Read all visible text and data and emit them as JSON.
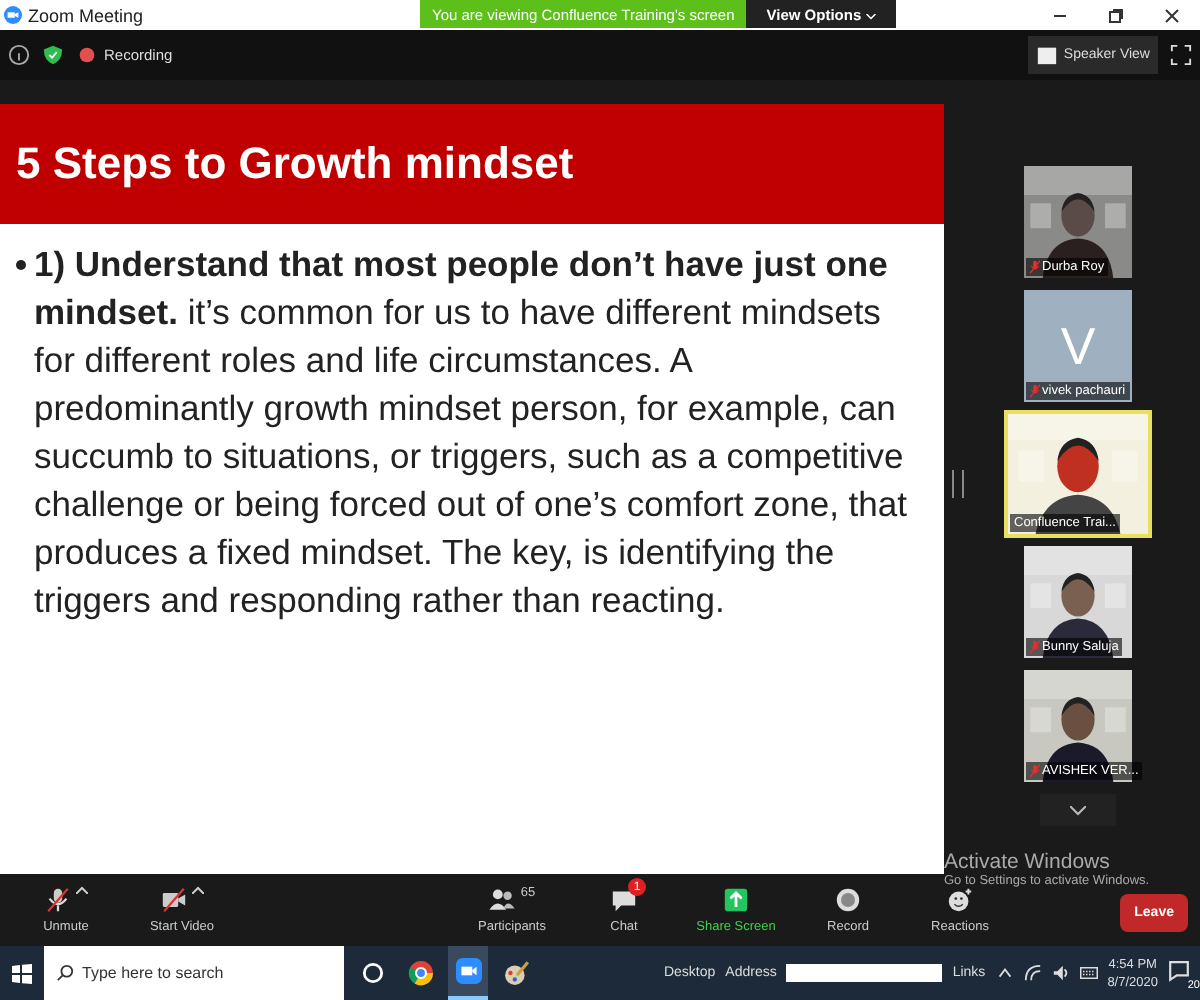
{
  "window": {
    "title": "Zoom Meeting"
  },
  "banner": {
    "text": "You are viewing Confluence Training's screen",
    "button": "View Options"
  },
  "top_bar": {
    "recording": "Recording",
    "view_button": "Speaker View"
  },
  "slide": {
    "title": "5 Steps to Growth mindset",
    "bullet": "**1) Understand that most people don’t have just one mindset.** it’s common for us to have different mindsets for different roles and life circumstances. A predominantly growth mindset person, for example, can succumb to situations, or triggers, such as a competitive challenge or being forced out of one’s comfort zone, that produces a fixed mindset. The key, is identifying the triggers and responding rather than reacting."
  },
  "participants": [
    {
      "name": "Durba Roy",
      "kind": "video",
      "muted": true,
      "speaking": false
    },
    {
      "name": "vivek pachauri",
      "kind": "avatar",
      "initial": "V",
      "muted": true,
      "speaking": false
    },
    {
      "name": "Confluence Trai...",
      "kind": "video",
      "muted": false,
      "speaking": true
    },
    {
      "name": "Bunny Saluja",
      "kind": "video",
      "muted": true,
      "speaking": false
    },
    {
      "name": "AVISHEK VER...",
      "kind": "video",
      "muted": true,
      "speaking": false
    }
  ],
  "toolbar": [
    {
      "label": "Unmute",
      "kind": "mic"
    },
    {
      "label": "Start Video",
      "kind": "video"
    },
    {
      "label": "Participants",
      "kind": "participants",
      "count": "65"
    },
    {
      "label": "Chat",
      "kind": "chat",
      "badge": "1"
    },
    {
      "label": "Share Screen",
      "kind": "share"
    },
    {
      "label": "Record",
      "kind": "record"
    },
    {
      "label": "Reactions",
      "kind": "reactions"
    }
  ],
  "leave": "Leave",
  "activation": {
    "title": "Activate Windows",
    "subtitle": "Go to Settings to activate Windows."
  },
  "taskbar": {
    "search_placeholder": "Type here to search",
    "desktop": "Desktop",
    "address": "Address",
    "links": "Links",
    "time": "4:54 PM",
    "date": "8/7/2020",
    "notifications": "20"
  }
}
